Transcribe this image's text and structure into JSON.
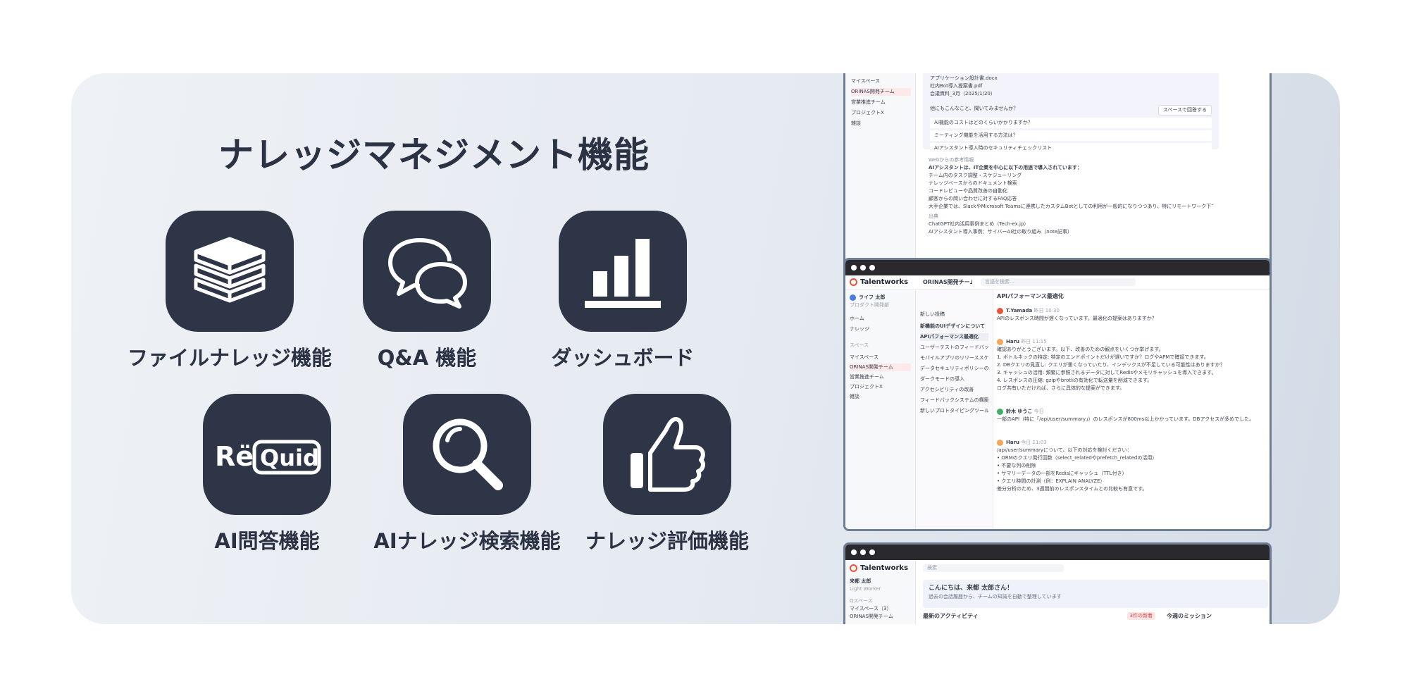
{
  "headline": "ナレッジマネジメント機能",
  "features": [
    {
      "label": "ファイルナレッジ機能",
      "icon": "stacked-layers-icon"
    },
    {
      "label": "Q&A 機能",
      "icon": "chat-bubbles-icon"
    },
    {
      "label": "ダッシュボード",
      "icon": "bar-chart-icon"
    },
    {
      "label": "AI問答機能",
      "icon": "requid-logo-icon"
    },
    {
      "label": "AIナレッジ検索機能",
      "icon": "magnifier-icon"
    },
    {
      "label": "ナレッジ評価機能",
      "icon": "thumbs-up-icon"
    }
  ],
  "colors": {
    "tile": "#2d3547",
    "text": "#2b3244",
    "card_start": "#eef1f5",
    "card_end": "#d3dbe6",
    "brand_accent": "#e8553a"
  },
  "shot1": {
    "sidebar": [
      "マイスペース",
      "ORINAS開発チーム",
      "営業推進チーム",
      "プロジェクトX",
      "雑談"
    ],
    "refs": [
      "アプリケーション設計書.docx",
      "社内Bot導入提案書.pdf",
      "会議資料_3月（2025/1/20）"
    ],
    "suggest_label": "他にもこんなこと、聞いてみませんか？",
    "suggest_button": "スペースで回答する",
    "suggestions": [
      "AI機能のコストはどのくらいかかりますか？",
      "ミーティング機能を活用する方法は？",
      "AIアシスタント導入時のセキュリティチェックリスト"
    ],
    "answer_source": "Webからの参考情報",
    "answer_title": "AIアシスタントは、IT企業を中心に以下の用途で導入されています：",
    "answer_items": [
      "チーム内のタスク調整・スケジューリング",
      "ナレッジベースからのドキュメント検索",
      "コードレビューや品質改善の自動化",
      "顧客からの問い合わせに対するFAQ応答"
    ],
    "answer_body": "大手企業では、SlackやMicrosoft Teamsに連携したカスタムBotとしての利用が一般的になりつつあり、特にリモートワーク下での情報共有の効率化に貢献しています。",
    "sources_label": "出典",
    "sources": [
      "ChatGPT社内活用事例まとめ（Tech-ex.jp）",
      "AIアシスタント導入事例：サイバーAI社の取り組み（note記事）"
    ]
  },
  "shot2": {
    "brand": "Talentworks",
    "team_title": "ORINAS開発チーム",
    "search_placeholder": "言語を検索...",
    "user_name": "ライフ 太郎",
    "user_role": "プロダクト開発部",
    "nav": [
      "ホーム",
      "ナレッジ"
    ],
    "space_search": "スペース",
    "spaces": [
      "マイスペース",
      "ORINAS開発チーム",
      "営業推進チーム",
      "プロジェクトX",
      "雑談"
    ],
    "thread_new": "新しい投稿",
    "threads": [
      "新機能のUIデザインについて",
      "APIパフォーマンス最適化",
      "ユーザーテストのフィードバック",
      "モバイルアプリのリリーススケジュール",
      "データセキュリティポリシーの更新",
      "ダークモードの導入",
      "アクセシビリティの改善",
      "フィードバックシステムの構築",
      "新しいプロトタイピングツールの検討"
    ],
    "chat_title": "APIパフォーマンス最適化",
    "messages": [
      {
        "name": "T.Yamada",
        "time": "昨日 10:30",
        "lines": [
          "APIのレスポンス時間が遅くなっています。最適化の提案はありますか？"
        ]
      },
      {
        "name": "Haru",
        "time": "昨日 11:15",
        "lines": [
          "確認ありがとうございます。以下、改善のための観点をいくつか挙げます。",
          "1. ボトルネックの特定: 特定のエンドポイントだけが遅いですか？ログやAPMで確認できます。",
          "2. DBクエリの見直し: クエリが重くなっていたり、インデックスが不足している可能性はありますか？",
          "3. キャッシュの活用: 頻繁に参照されるデータに対してRedisやメモリキャッシュを導入できます。",
          "4. レスポンスの圧縮: gzipやbrotliの有効化で転送量を削減できます。",
          "ログ共有いただければ、さらに具体的な提案ができます。"
        ]
      },
      {
        "name": "鈴木 ゆうこ",
        "time": "今日",
        "lines": [
          "一部のAPI（特に「/api/user/summary」）のレスポンスが800ms以上かかっています。DBアクセスが多めでした。"
        ]
      },
      {
        "name": "Haru",
        "time": "今日 11:03",
        "lines": [
          "/api/user/summaryについて、以下の対応を検討ください：",
          "• ORMのクエリ発行回数（select_relatedやprefetch_relatedの活用）",
          "• 不要な列の削除",
          "• サマリーデータの一部をRedisにキャッシュ（TTL付き）",
          "• クエリ時間の計測（例：EXPLAIN ANALYZE）",
          "差分分析のため、3週間前のレスポンスタイムとの比較も有意です。"
        ]
      }
    ]
  },
  "shot3": {
    "brand": "Talentworks",
    "search_placeholder": "検索",
    "user_name": "来都 太郎",
    "user_role": "Light Worker",
    "space_label": "Qスペース",
    "greeting": "こんにちは、来都 太郎さん！",
    "greeting_sub": "過去の会話履歴から、チームの知識を自動で整理しています",
    "activity_title": "最新のアクティビティ",
    "activity_badge": "3件の新着",
    "mission_title": "今週のミッション",
    "side_items": [
      "マイスペース（3）",
      "ORINAS開発チーム"
    ]
  }
}
